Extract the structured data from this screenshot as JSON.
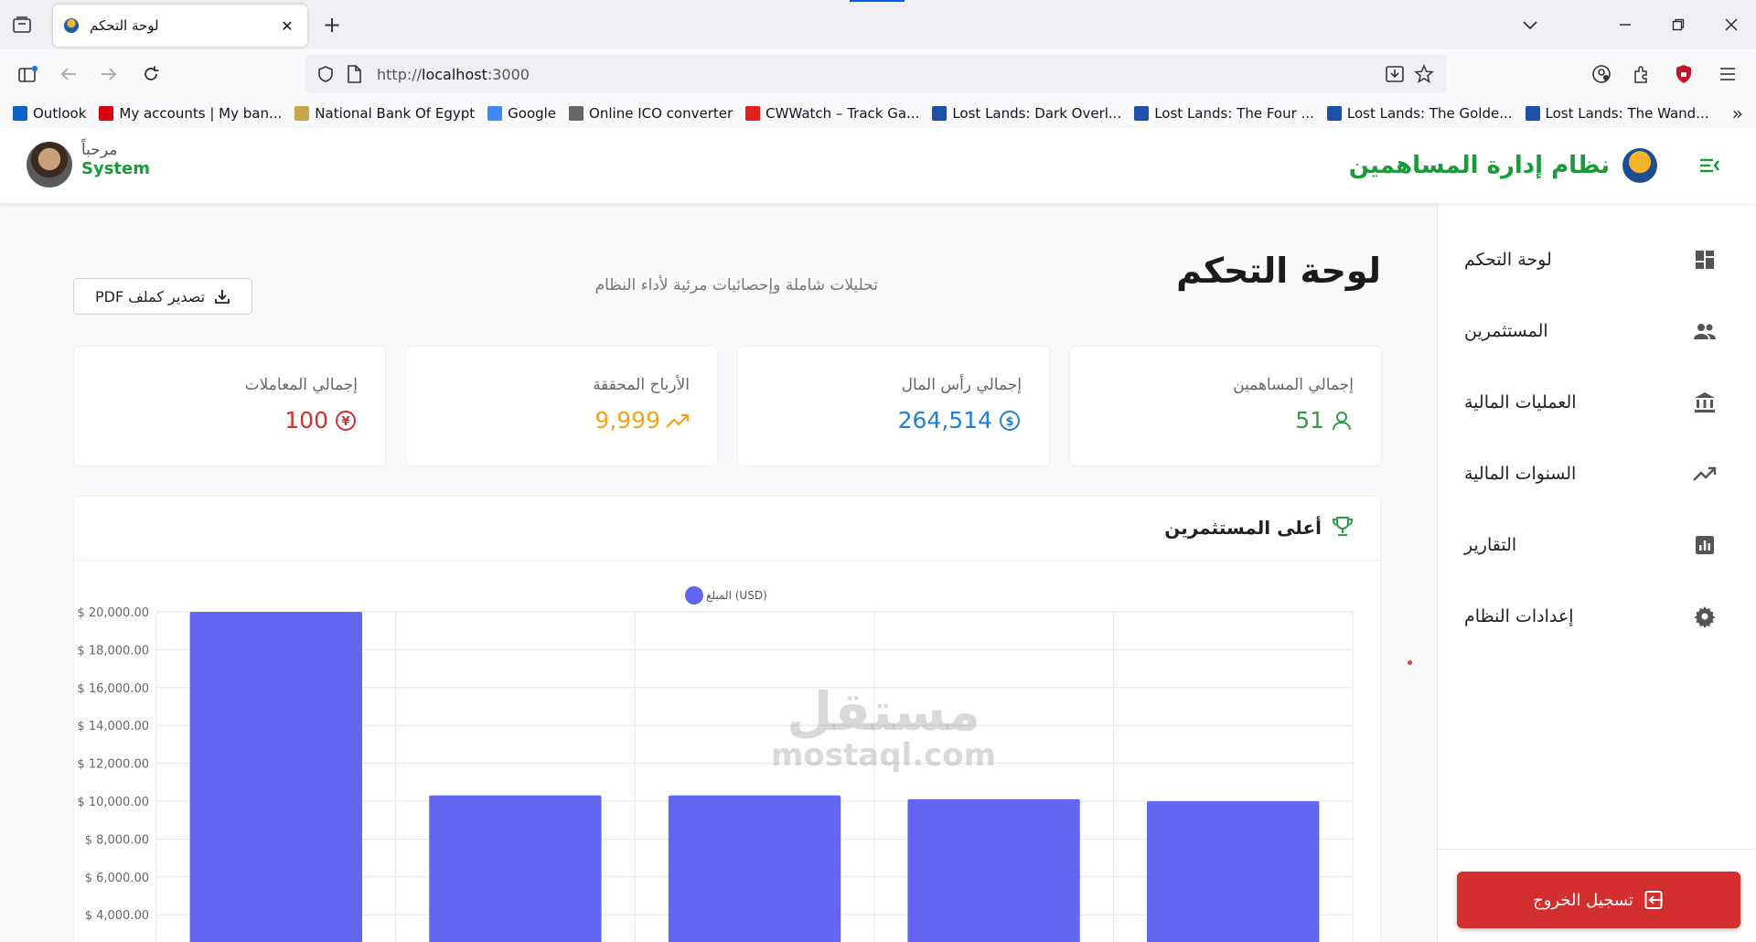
{
  "browser": {
    "tab_title": "لوحة التحكم",
    "url_scheme": "http://",
    "url_host": "localhost",
    "url_port": ":3000",
    "bookmarks": [
      {
        "label": "Outlook",
        "color": "#0a64c8"
      },
      {
        "label": "My accounts | My ban...",
        "color": "#db0011"
      },
      {
        "label": "National Bank Of Egypt",
        "color": "#c9a64a"
      },
      {
        "label": "Google",
        "color": "#4285f4"
      },
      {
        "label": "Online ICO converter",
        "color": "#666666"
      },
      {
        "label": "CWWatch – Track Ga...",
        "color": "#e01f1f"
      },
      {
        "label": "Lost Lands: Dark Overl...",
        "color": "#1f4fa8"
      },
      {
        "label": "Lost Lands: The Four ...",
        "color": "#1f4fa8"
      },
      {
        "label": "Lost Lands: The Golde...",
        "color": "#1f4fa8"
      },
      {
        "label": "Lost Lands: The Wand...",
        "color": "#1f4fa8"
      }
    ]
  },
  "header": {
    "greeting": "مرحباً",
    "user_name": "System",
    "brand_name": "نظام إدارة المساهمين"
  },
  "sidebar": {
    "items": [
      {
        "label": "لوحة التحكم",
        "icon": "dashboard-icon"
      },
      {
        "label": "المستثمرين",
        "icon": "people-icon"
      },
      {
        "label": "العمليات المالية",
        "icon": "bank-icon"
      },
      {
        "label": "السنوات المالية",
        "icon": "trending-icon"
      },
      {
        "label": "التقارير",
        "icon": "report-icon"
      },
      {
        "label": "إعدادات النظام",
        "icon": "gear-icon"
      }
    ],
    "logout_label": "تسجيل الخروج"
  },
  "main": {
    "title": "لوحة التحكم",
    "subtitle": "تحليلات شاملة وإحصائيات مرئية لأداء النظام",
    "export_label": "تصدير كملف PDF",
    "stats": [
      {
        "label": "إجمالي المساهمين",
        "value": "51",
        "color": "#2e9e45",
        "icon": "person-icon"
      },
      {
        "label": "إجمالي رأس المال",
        "value": "264,514",
        "color": "#1e7fd6",
        "icon": "dollar-icon"
      },
      {
        "label": "الأرباح المحققة",
        "value": "9,999",
        "color": "#f2a31b",
        "icon": "trend-up-icon"
      },
      {
        "label": "إجمالي المعاملات",
        "value": "100",
        "color": "#d32f2f",
        "icon": "exchange-icon"
      }
    ],
    "chart_title": "أعلى المستثمرين"
  },
  "chart_data": {
    "type": "bar",
    "title": "أعلى المستثمرين",
    "series": [
      {
        "name": "المبلغ (USD)",
        "color": "#6366f1",
        "values": [
          20000,
          10300,
          10300,
          10100,
          10000
        ]
      }
    ],
    "categories": [
      "",
      "",
      "",
      "",
      ""
    ],
    "ytick_labels": [
      "$ 20,000.00",
      "$ 18,000.00",
      "$ 16,000.00",
      "$ 14,000.00",
      "$ 12,000.00",
      "$ 10,000.00",
      "$ 8,000.00",
      "$ 6,000.00",
      "$ 4,000.00"
    ],
    "yticks": [
      20000,
      18000,
      16000,
      14000,
      12000,
      10000,
      8000,
      6000,
      4000
    ],
    "ylim": [
      4000,
      20000
    ],
    "grid": true,
    "legend": "top-center"
  },
  "watermark": {
    "arabic": "مستقل",
    "latin": "mostaql.com"
  }
}
